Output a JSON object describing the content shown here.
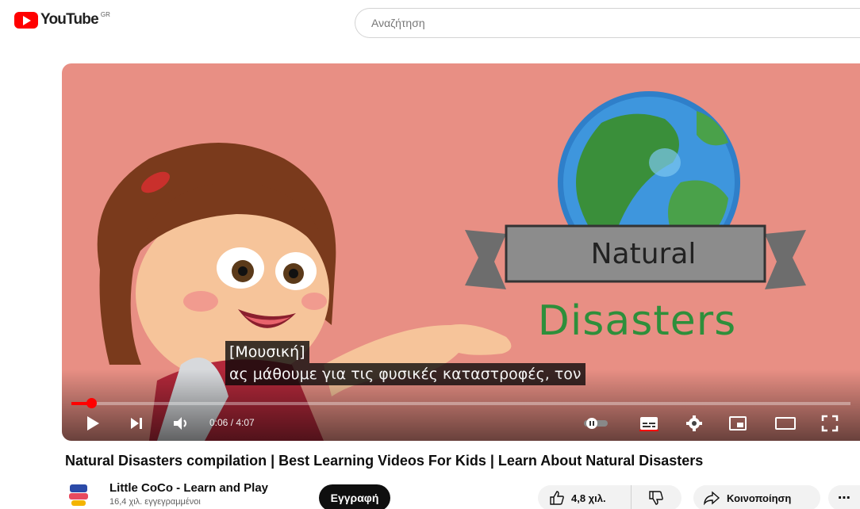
{
  "header": {
    "logo_text": "YouTube",
    "region": "GR",
    "search_placeholder": "Αναζήτηση"
  },
  "player": {
    "thumbnail_title_line1": "Natural",
    "thumbnail_title_line2": "Disasters",
    "captions": [
      "[Μουσική]",
      "ας μάθουμε για τις φυσικές καταστροφές, τον"
    ],
    "time_display": "0:06 / 4:07",
    "progress_fraction": 0.025,
    "accent_color": "#ff0000",
    "controls": [
      "play-icon",
      "next-icon",
      "volume-icon",
      "autoplay-toggle-icon",
      "subtitles-icon",
      "settings-icon",
      "miniplayer-icon",
      "theater-icon",
      "fullscreen-icon"
    ]
  },
  "video": {
    "title": "Natural Disasters compilation | Best Learning Videos For Kids | Learn About Natural Disasters",
    "channel_name": "Little CoCo - Learn and Play",
    "subscribers": "16,4 χιλ. εγγεγραμμένοι",
    "subscribe_label": "Εγγραφή",
    "likes": "4,8 χιλ.",
    "share_label": "Κοινοποίηση",
    "more_label": "⋯"
  }
}
